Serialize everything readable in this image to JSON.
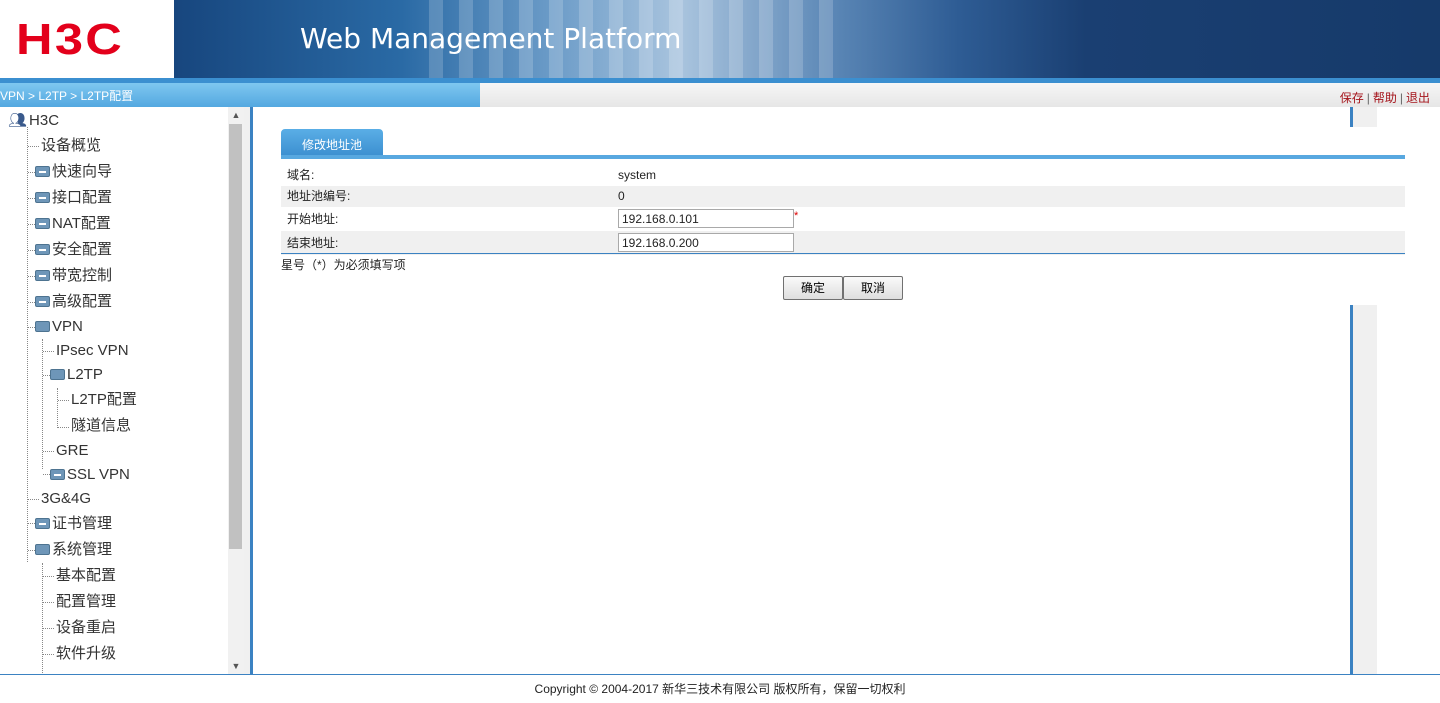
{
  "header": {
    "logo": "H3C",
    "title": "Web Management Platform"
  },
  "locbar": {
    "breadcrumb": "VPN > L2TP > L2TP配置",
    "links": {
      "save": "保存",
      "help": "帮助",
      "logout": "退出"
    }
  },
  "sidebar": {
    "root": "H3C",
    "items": [
      "设备概览",
      "快速向导",
      "接口配置",
      "NAT配置",
      "安全配置",
      "带宽控制",
      "高级配置",
      "VPN",
      "IPsec VPN",
      "L2TP",
      "L2TP配置",
      "隧道信息",
      "GRE",
      "SSL VPN",
      "3G&4G",
      "证书管理",
      "系统管理",
      "基本配置",
      "配置管理",
      "设备重启",
      "软件升级"
    ]
  },
  "main": {
    "tab": "修改地址池",
    "fields": {
      "domain_label": "域名:",
      "domain_value": "system",
      "pool_label": "地址池编号:",
      "pool_value": "0",
      "start_label": "开始地址:",
      "start_value": "192.168.0.101",
      "end_label": "结束地址:",
      "end_value": "192.168.0.200",
      "required_mark": "*"
    },
    "note": "星号（*）为必须填写项",
    "ok": "确定",
    "cancel": "取消"
  },
  "footer": {
    "copyright": "Copyright © 2004-2017 新华三技术有限公司 版权所有，保留一切权利"
  },
  "colors": {
    "brand_red": "#e3001b",
    "accent_blue": "#3b82c2"
  }
}
